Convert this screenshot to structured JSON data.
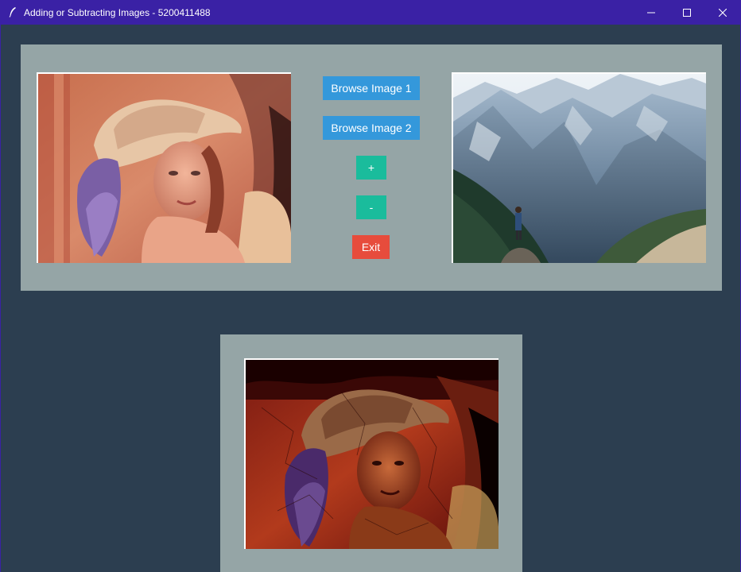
{
  "window": {
    "title": "Adding or Subtracting Images  - 5200411488",
    "controls": [
      "minimize",
      "maximize",
      "close"
    ]
  },
  "colors": {
    "background": "#2c3e50",
    "panel": "#95a5a6",
    "titlebar": "#3a21a5",
    "browse_button": "#3498db",
    "operation_button": "#1abc9c",
    "exit_button": "#e74c3c"
  },
  "buttons": {
    "browse1": "Browse Image 1",
    "browse2": "Browse Image 2",
    "add": "+",
    "subtract": "-",
    "exit": "Exit"
  },
  "images": {
    "image1": "portrait-photo-woman-with-hat",
    "image2": "mountain-valley-landscape-photo",
    "result": "blended-result-image"
  }
}
